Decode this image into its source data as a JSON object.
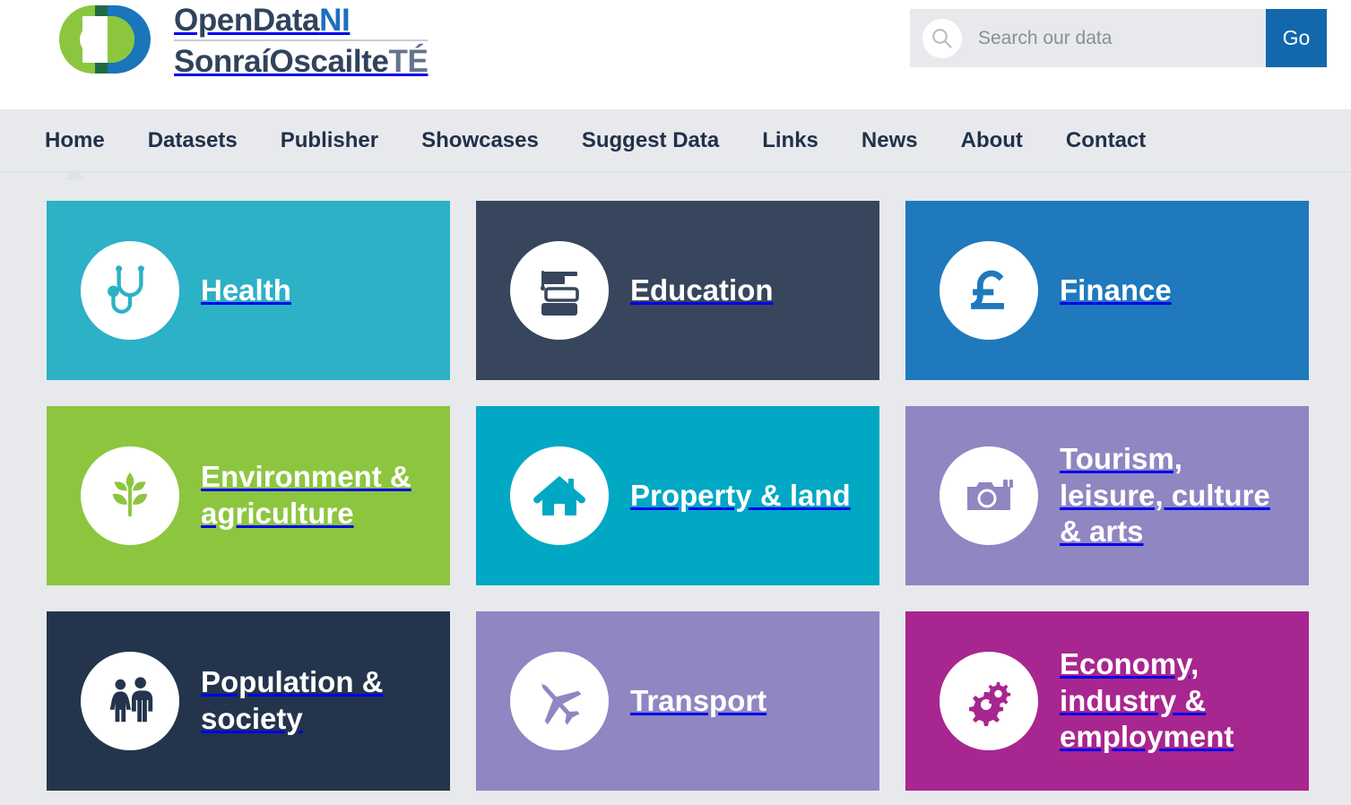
{
  "brand": {
    "line1_a": "OpenData",
    "line1_b": "NI",
    "line2_a": "SonraíOscailte",
    "line2_b": "TÉ",
    "mark_icon": "opendata-ni-logo",
    "colors": {
      "green": "#8cc63f",
      "blue": "#1b75bb",
      "dark_green": "#1f6b43"
    }
  },
  "search": {
    "icon": "search-icon",
    "placeholder": "Search our data",
    "value": "",
    "button_label": "Go",
    "button_color": "#1267ad"
  },
  "nav": {
    "items": [
      {
        "label": "Home",
        "active": true
      },
      {
        "label": "Datasets",
        "active": false
      },
      {
        "label": "Publisher",
        "active": false
      },
      {
        "label": "Showcases",
        "active": false
      },
      {
        "label": "Suggest Data",
        "active": false
      },
      {
        "label": "Links",
        "active": false
      },
      {
        "label": "News",
        "active": false
      },
      {
        "label": "About",
        "active": false
      },
      {
        "label": "Contact",
        "active": false
      }
    ]
  },
  "tiles": [
    {
      "label": "Health",
      "icon": "stethoscope-icon",
      "color": "#2cb1c6"
    },
    {
      "label": "Education",
      "icon": "books-icon",
      "color": "#37465c"
    },
    {
      "label": "Finance",
      "icon": "pound-icon",
      "color": "#2079bd"
    },
    {
      "label": "Environment & agriculture",
      "icon": "plant-icon",
      "color": "#8cc63f"
    },
    {
      "label": "Property & land",
      "icon": "house-icon",
      "color": "#00a8c4"
    },
    {
      "label": "Tourism, leisure, culture & arts",
      "icon": "camera-icon",
      "color": "#8f86c2"
    },
    {
      "label": "Population & society",
      "icon": "people-icon",
      "color": "#23344c"
    },
    {
      "label": "Transport",
      "icon": "airplane-icon",
      "color": "#8f86c2"
    },
    {
      "label": "Economy, industry & employment",
      "icon": "gears-icon",
      "color": "#a8268f"
    }
  ]
}
